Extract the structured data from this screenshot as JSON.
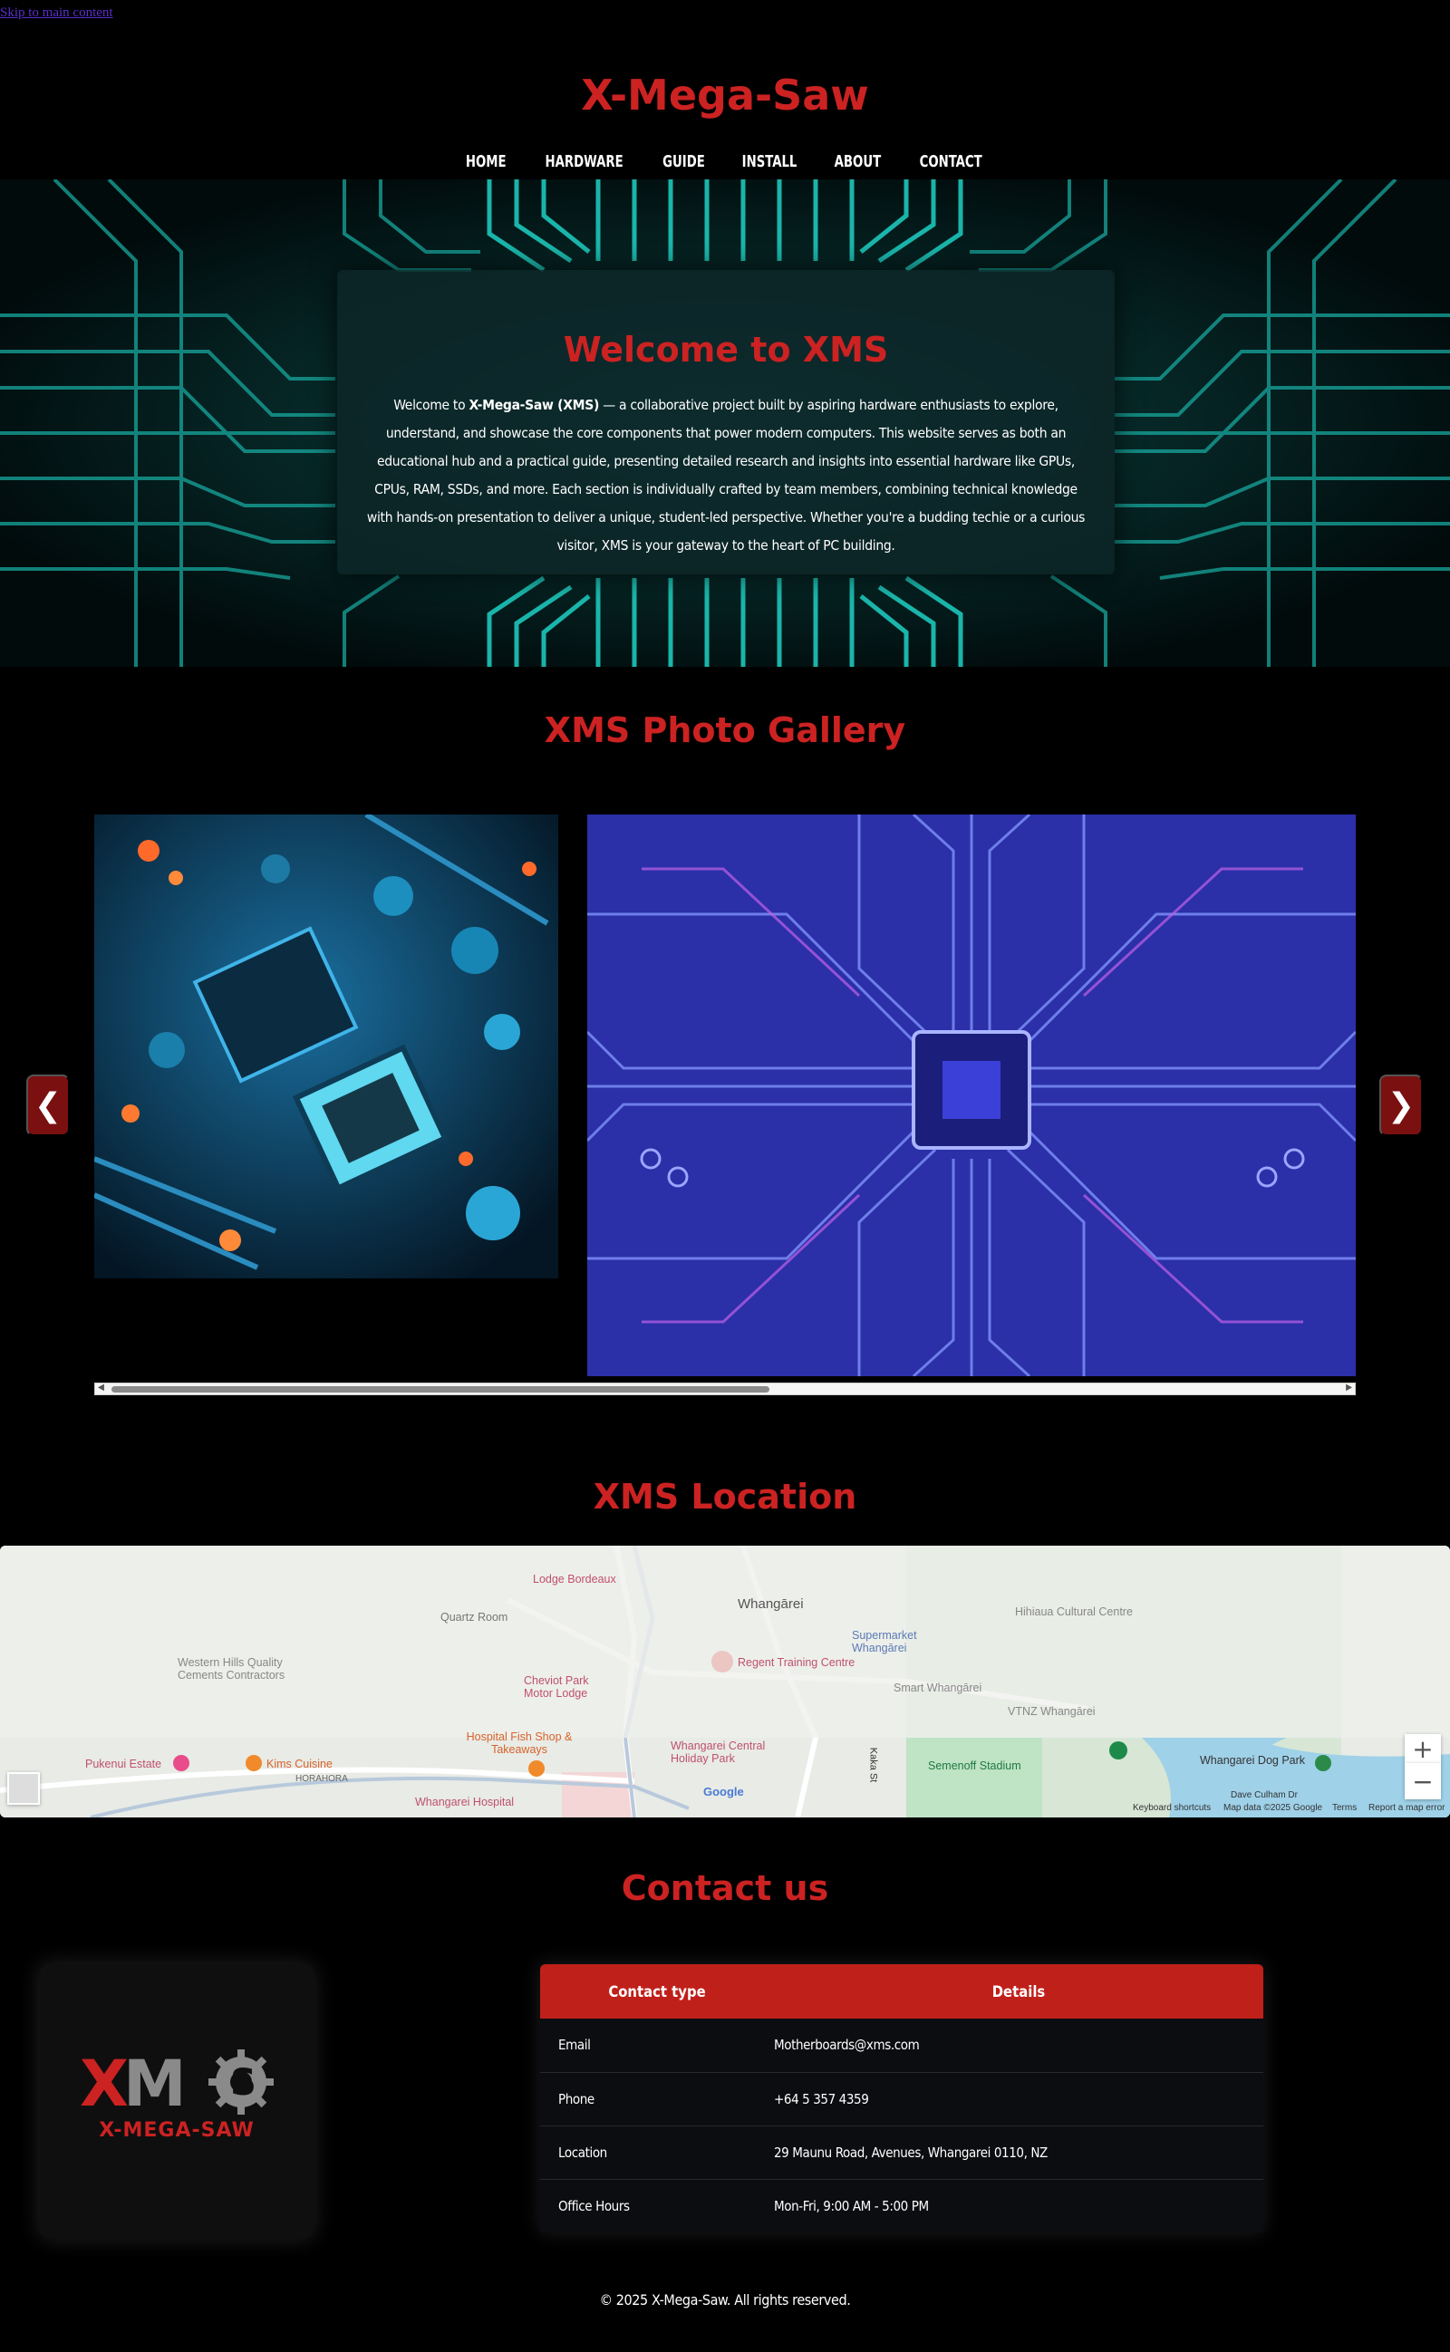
{
  "skip_link": "Skip to main content",
  "site": {
    "title": "X-Mega-Saw"
  },
  "nav": {
    "items": [
      "HOME",
      "HARDWARE",
      "GUIDE",
      "INSTALL",
      "ABOUT",
      "CONTACT"
    ]
  },
  "hero": {
    "heading": "Welcome to XMS",
    "intro_prefix": "Welcome to ",
    "intro_bold": "X-Mega-Saw (XMS)",
    "intro_rest": " — a collaborative project built by aspiring hardware enthusiasts to explore, understand, and showcase the core components that power modern computers. This website serves as both an educational hub and a practical guide, presenting detailed research and insights into essential hardware like GPUs, CPUs, RAM, SSDs, and more. Each section is individually crafted by team members, combining technical knowledge with hands-on presentation to deliver a unique, student-led perspective. Whether you're a budding techie or a curious visitor, XMS is your gateway to the heart of PC building."
  },
  "gallery": {
    "title": "XMS Photo Gallery",
    "prev_label": "❮",
    "next_label": "❯"
  },
  "location": {
    "title": "XMS Location",
    "map_labels": {
      "lodge": "Lodge Bordeaux",
      "quartz": "Quartz Room",
      "whangarei": "Whangārei",
      "western_hills": "Western Hills Quality Cements Contractors",
      "cheviot": "Cheviot Park Motor Lodge",
      "regent": "Regent Training Centre",
      "supermarket": "Supermarket Whangārei",
      "hihiaua": "Hihiaua Cultural Centre",
      "smart": "Smart Whangārei",
      "vtnz": "VTNZ Whangārei",
      "fishshop": "Hospital Fish Shop & Takeaways",
      "pukenui": "Pukenui Estate",
      "kims": "Kims Cuisine",
      "horahora": "HORAHORA",
      "holiday": "Whangarei Central Holiday Park",
      "semenoff": "Semenoff Stadium",
      "dogpark": "Whangarei Dog Park",
      "hospital": "Whangarei Hospital",
      "dave": "Dave Culham Dr",
      "kaka": "Kaka St",
      "google": "Google",
      "shortcuts": "Keyboard shortcuts",
      "mapdata": "Map data ©2025 Google",
      "terms": "Terms",
      "report": "Report a map error"
    },
    "zoom_in": "+",
    "zoom_out": "−"
  },
  "contact": {
    "title": "Contact us",
    "logo_text_main": "XM",
    "logo_text_sub": "X-MEGA-SAW",
    "headers": [
      "Contact type",
      "Details"
    ],
    "rows": [
      {
        "type": "Email",
        "details": "Motherboards@xms.com"
      },
      {
        "type": "Phone",
        "details": "+64 5 357 4359"
      },
      {
        "type": "Location",
        "details": "29 Maunu Road, Avenues, Whangarei 0110, NZ"
      },
      {
        "type": "Office Hours",
        "details": "Mon-Fri, 9:00 AM - 5:00 PM"
      }
    ]
  },
  "footer": {
    "text": "© 2025 X-Mega-Saw. All rights reserved."
  },
  "colors": {
    "accent_red": "#cc2222",
    "table_header": "#c0201a",
    "background": "#000000",
    "circuit_cyan": "#1fd1c4"
  }
}
